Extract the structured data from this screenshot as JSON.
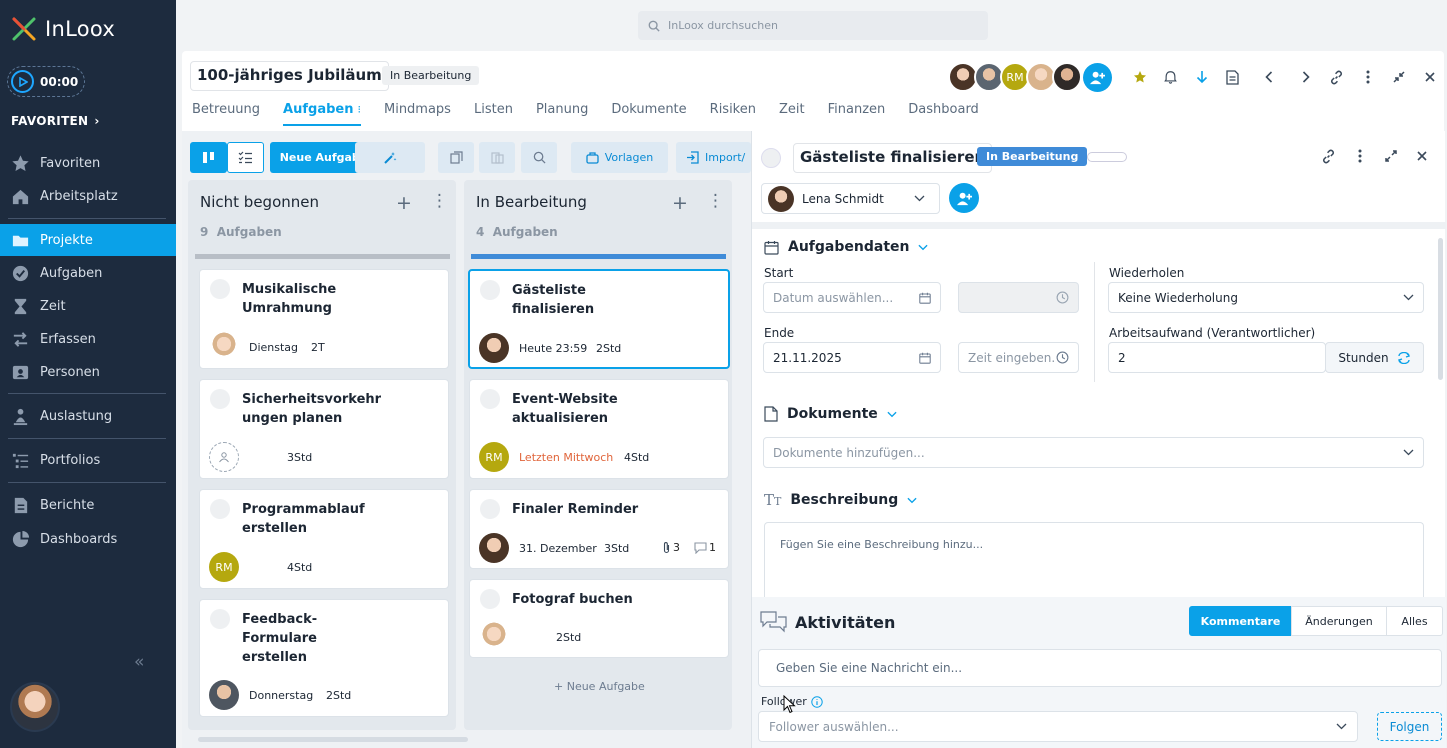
{
  "app": {
    "logo_text": "InLoox",
    "timer": "00:00",
    "favorites_heading": "FAVORITEN"
  },
  "sidebar": {
    "items": [
      {
        "label": "Favoriten",
        "icon": "star-icon"
      },
      {
        "label": "Arbeitsplatz",
        "icon": "home-icon"
      },
      {
        "label": "Projekte",
        "icon": "folder-icon"
      },
      {
        "label": "Aufgaben",
        "icon": "check-circle-icon"
      },
      {
        "label": "Zeit",
        "icon": "hourglass-icon"
      },
      {
        "label": "Erfassen",
        "icon": "swap-icon"
      },
      {
        "label": "Personen",
        "icon": "person-card-icon"
      },
      {
        "label": "Auslastung",
        "icon": "person-load-icon"
      },
      {
        "label": "Portfolios",
        "icon": "portfolio-icon"
      },
      {
        "label": "Berichte",
        "icon": "report-icon"
      },
      {
        "label": "Dashboards",
        "icon": "pie-icon"
      }
    ],
    "collapse": "«"
  },
  "search": {
    "placeholder": "InLoox durchsuchen"
  },
  "project": {
    "title": "100-jähriges Jubiläum",
    "status": "In Bearbeitung",
    "member_initials": "RM",
    "tabs": [
      "Betreuung",
      "Aufgaben",
      "Mindmaps",
      "Listen",
      "Planung",
      "Dokumente",
      "Risiken",
      "Zeit",
      "Finanzen",
      "Dashboard"
    ],
    "active_tab": "Aufgaben"
  },
  "toolbar": {
    "new_task": "Neue Aufgabe",
    "templates": "Vorlagen",
    "import": "Import/"
  },
  "columns": [
    {
      "title": "Nicht begonnen",
      "count": "9",
      "count_label": "Aufgaben",
      "cards": [
        {
          "title": "Musikalische Umrahmung",
          "date": "Dienstag",
          "hours": "2T"
        },
        {
          "title": "Sicherheitsvorkehr ungen planen",
          "date": "",
          "hours": "3Std"
        },
        {
          "title": "Programmablauf erstellen",
          "date": "",
          "hours": "4Std",
          "initials": "RM"
        },
        {
          "title": "Feedback-Formulare erstellen",
          "date": "Donnerstag",
          "hours": "2Std"
        }
      ]
    },
    {
      "title": "In Bearbeitung",
      "count": "4",
      "count_label": "Aufgaben",
      "cards": [
        {
          "title": "Gästeliste finalisieren",
          "date": "Heute 23:59",
          "hours": "2Std"
        },
        {
          "title": "Event-Website aktualisieren",
          "date": "Letzten Mittwoch",
          "hours": "4Std",
          "initials": "RM"
        },
        {
          "title": "Finaler Reminder",
          "date": "31. Dezember",
          "hours": "3Std",
          "attachments": "3",
          "comments": "1"
        },
        {
          "title": "Fotograf buchen",
          "date": "",
          "hours": "2Std"
        }
      ],
      "new_task": "Neue Aufgabe"
    }
  ],
  "detail": {
    "title": "Gästeliste finalisieren",
    "status": "In Bearbeitung",
    "responsible": "Lena Schmidt",
    "sections": {
      "task_data": "Aufgabendaten",
      "documents": "Dokumente",
      "description": "Beschreibung"
    },
    "start_label": "Start",
    "start_placeholder": "Datum auswählen...",
    "end_label": "Ende",
    "end_value": "21.11.2025",
    "time_placeholder": "Zeit eingeben.",
    "repeat_label": "Wiederholen",
    "repeat_value": "Keine Wiederholung",
    "effort_label": "Arbeitsaufwand (Verantwortlicher)",
    "effort_value": "2",
    "effort_unit": "Stunden",
    "documents_placeholder": "Dokumente hinzufügen...",
    "description_placeholder": "Fügen Sie eine Beschreibung hinzu..."
  },
  "activities": {
    "title": "Aktivitäten",
    "tabs": [
      "Kommentare",
      "Änderungen",
      "Alles"
    ],
    "message_placeholder": "Geben Sie eine Nachricht ein...",
    "follower_label": "Follower",
    "follower_placeholder": "Follower auswählen...",
    "follow_button": "Folgen"
  },
  "colors": {
    "accent": "#0aa1e8",
    "sidebar": "#1d2b3e",
    "status_blue": "#3f8bd8",
    "rm_avatar": "#b5a80f",
    "overdue": "#e0653b"
  }
}
